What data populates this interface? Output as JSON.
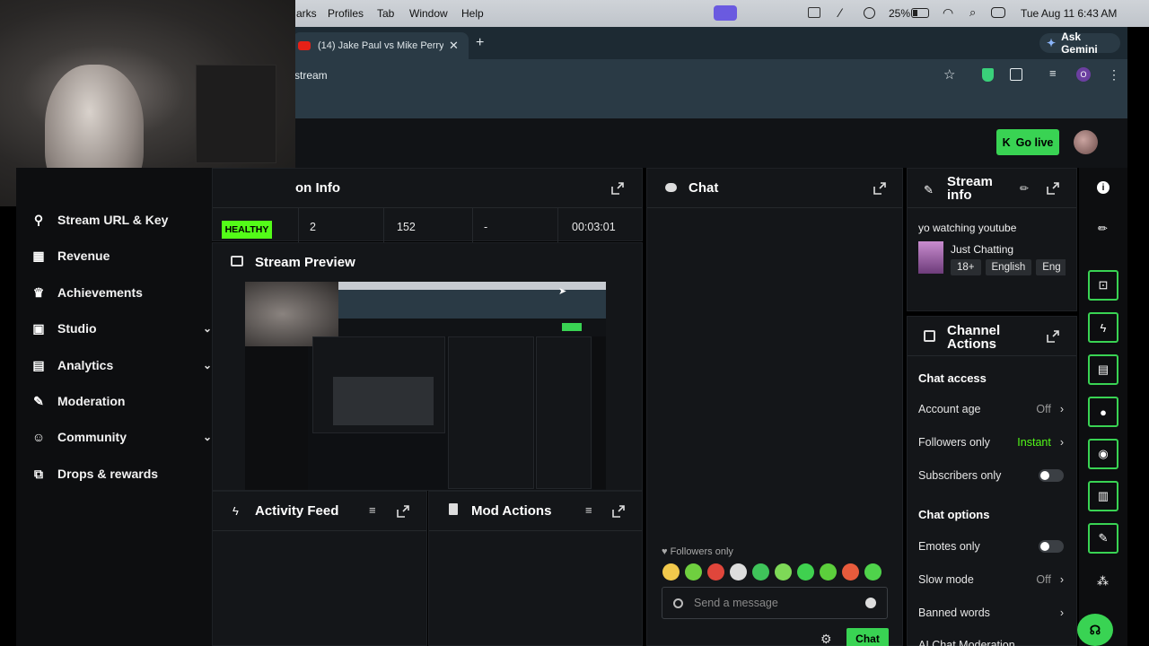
{
  "menubar": {
    "items": [
      "arks",
      "Profiles",
      "Tab",
      "Window",
      "Help"
    ],
    "battery": "25%",
    "clock": "Tue Aug 11  6:43 AM"
  },
  "browser": {
    "tab_title": "(14) Jake Paul vs Mike Perry",
    "url": "stream",
    "ask_gemini": "Ask Gemini",
    "profile_initial": "O"
  },
  "header": {
    "go_live": "Go live"
  },
  "sidebar": {
    "items": [
      {
        "label": "Stream URL & Key"
      },
      {
        "label": "Revenue"
      },
      {
        "label": "Achievements"
      },
      {
        "label": "Studio"
      },
      {
        "label": "Analytics"
      },
      {
        "label": "Moderation"
      },
      {
        "label": "Community"
      },
      {
        "label": "Drops & rewards"
      }
    ]
  },
  "session": {
    "title": "on Info",
    "status": "HEALTHY",
    "viewers": "2",
    "followers": "152",
    "subs": "-",
    "uptime": "00:03:01"
  },
  "preview": {
    "title": "Stream Preview"
  },
  "activity": {
    "title": "Activity Feed"
  },
  "mod": {
    "title": "Mod Actions"
  },
  "chat": {
    "title": "Chat",
    "mode": "Followers only",
    "placeholder": "Send a message",
    "send": "Chat"
  },
  "stream_info": {
    "title_l1": "Stream",
    "title_l2": "info",
    "stream_title": "yo watching youtube",
    "category": "Just Chatting",
    "tags": [
      "18+",
      "English",
      "Eng"
    ]
  },
  "channel_actions": {
    "title_l1": "Channel",
    "title_l2": "Actions",
    "chat_access": "Chat access",
    "account_age": "Account age",
    "account_age_val": "Off",
    "followers_only": "Followers only",
    "followers_only_val": "Instant",
    "subscribers_only": "Subscribers only",
    "chat_options": "Chat options",
    "emotes_only": "Emotes only",
    "slow_mode": "Slow mode",
    "slow_mode_val": "Off",
    "banned_words": "Banned words",
    "ai_moderation": "AI Chat Moderation"
  },
  "colors": {
    "accent": "#39d353",
    "healthy": "#53fc18"
  },
  "emote_colors": [
    "#f2c94c",
    "#6fcf3f",
    "#e0463b",
    "#dddddd",
    "#3fc45a",
    "#7ed957",
    "#3fd14f",
    "#5ccf3c",
    "#e85b3c",
    "#4fd34b"
  ]
}
